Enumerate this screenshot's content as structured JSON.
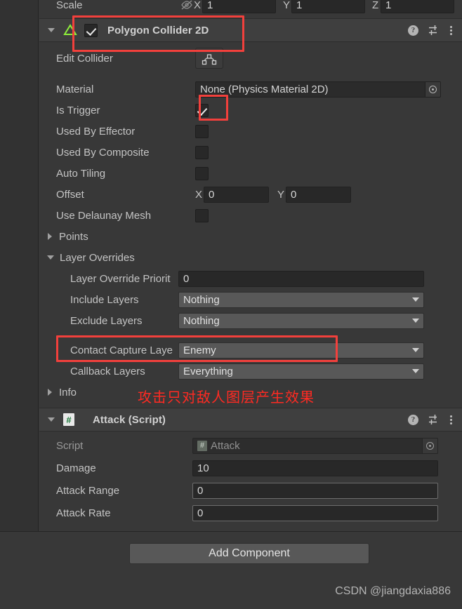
{
  "scale_row": {
    "label": "Scale",
    "link_icon": "link-off-icon",
    "x_label": "X",
    "x_value": "1",
    "y_label": "Y",
    "y_value": "1",
    "z_label": "Z",
    "z_value": "1"
  },
  "polygon_collider": {
    "title": "Polygon Collider 2D",
    "enabled": true,
    "icon": "polygon-collider-2d-icon",
    "help_icon": "help-icon",
    "preset_icon": "preset-settings-icon",
    "menu_icon": "more-options-icon",
    "rows": {
      "edit_collider": {
        "label": "Edit Collider",
        "button_icon": "edit-polygon-icon"
      },
      "material": {
        "label": "Material",
        "value": "None (Physics Material 2D)",
        "picker_icon": "object-picker-icon"
      },
      "is_trigger": {
        "label": "Is Trigger",
        "checked": true
      },
      "used_by_effector": {
        "label": "Used By Effector",
        "checked": false
      },
      "used_by_composite": {
        "label": "Used By Composite",
        "checked": false
      },
      "auto_tiling": {
        "label": "Auto Tiling",
        "checked": false
      },
      "offset": {
        "label": "Offset",
        "x_label": "X",
        "x_value": "0",
        "y_label": "Y",
        "y_value": "0"
      },
      "use_delaunay_mesh": {
        "label": "Use Delaunay Mesh",
        "checked": false
      },
      "points": {
        "label": "Points",
        "expanded": false
      },
      "layer_overrides": {
        "label": "Layer Overrides",
        "expanded": true
      },
      "layer_override_priority": {
        "label": "Layer Override Priorit",
        "value": "0"
      },
      "include_layers": {
        "label": "Include Layers",
        "value": "Nothing"
      },
      "exclude_layers": {
        "label": "Exclude Layers",
        "value": "Nothing"
      },
      "contact_capture_layers": {
        "label": "Contact Capture Laye",
        "value": "Enemy"
      },
      "callback_layers": {
        "label": "Callback Layers",
        "value": "Everything"
      },
      "info": {
        "label": "Info",
        "expanded": false
      }
    }
  },
  "attack_script": {
    "title": "Attack (Script)",
    "icon": "csharp-script-icon",
    "help_icon": "help-icon",
    "preset_icon": "preset-settings-icon",
    "menu_icon": "more-options-icon",
    "rows": {
      "script": {
        "label": "Script",
        "value": "Attack",
        "picker_icon": "object-picker-icon"
      },
      "damage": {
        "label": "Damage",
        "value": "10"
      },
      "attack_range": {
        "label": "Attack Range",
        "value": "0"
      },
      "attack_rate": {
        "label": "Attack Rate",
        "value": "0"
      }
    }
  },
  "footer": {
    "add_component_label": "Add Component",
    "watermark": "CSDN @jiangdaxia886"
  },
  "annotations": {
    "chinese_note": "攻击只对敌人图层产生效果",
    "highlight_color": "#f2403c"
  }
}
